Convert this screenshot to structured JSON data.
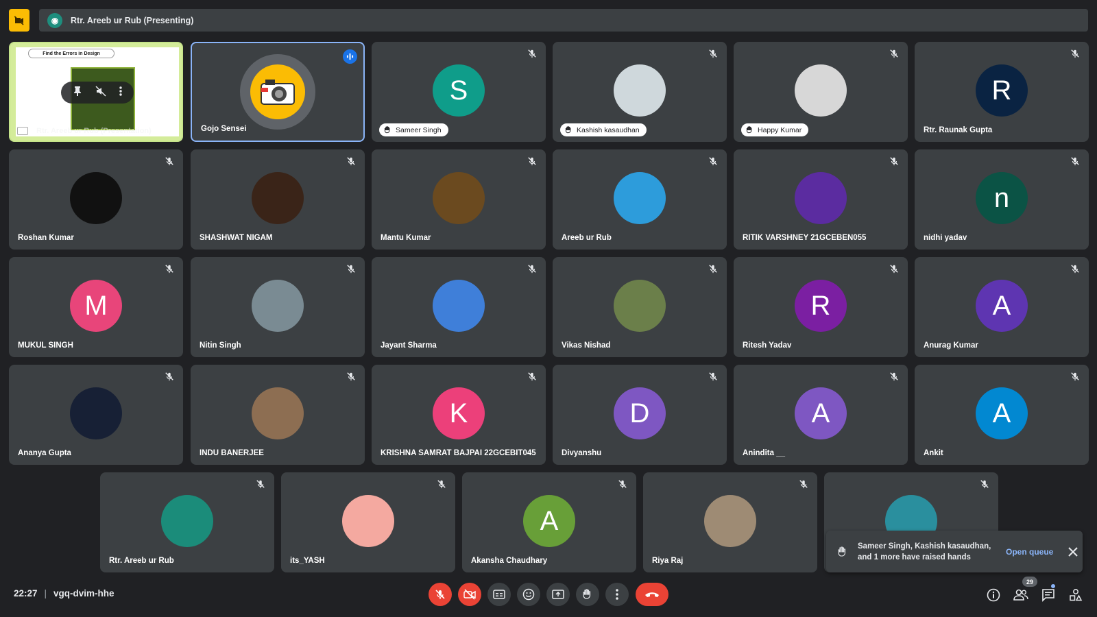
{
  "presenting_bar": {
    "text": "Rtr. Areeb ur Rub (Presenting)"
  },
  "presentation_tile": {
    "slide_title": "Find the Errors in Design",
    "label": "Rtr. Areeb ur Rub (Presentation)"
  },
  "gojo": {
    "name": "Gojo Sensei"
  },
  "tiles": [
    {
      "name": "Sameer Singh",
      "initial": "S",
      "color": "#0f9d8a",
      "hand": true
    },
    {
      "name": "Kashish kasaudhan",
      "initial": "",
      "color": "#cfd8dc",
      "hand": true
    },
    {
      "name": "Happy Kumar",
      "initial": "",
      "color": "#d7d7d7",
      "hand": true
    },
    {
      "name": "Rtr. Raunak Gupta",
      "initial": "R",
      "color": "#0a2342",
      "hand": false
    },
    {
      "name": "Roshan Kumar",
      "initial": "",
      "color": "#111111",
      "hand": false
    },
    {
      "name": "SHASHWAT NIGAM",
      "initial": "",
      "color": "#3a2418",
      "hand": false
    },
    {
      "name": "Mantu Kumar",
      "initial": "",
      "color": "#6b4a1f",
      "hand": false
    },
    {
      "name": "Areeb ur Rub",
      "initial": "",
      "color": "#2d9cdb",
      "hand": false
    },
    {
      "name": "RITIK VARSHNEY 21GCEBEN055",
      "initial": "",
      "color": "#5b2ca0",
      "hand": false
    },
    {
      "name": "nidhi yadav",
      "initial": "n",
      "color": "#0b5345",
      "hand": false
    },
    {
      "name": "MUKUL SINGH",
      "initial": "M",
      "color": "#e8457a",
      "hand": false
    },
    {
      "name": "Nitin Singh",
      "initial": "",
      "color": "#7a8b93",
      "hand": false
    },
    {
      "name": "Jayant Sharma",
      "initial": "",
      "color": "#3f7fd9",
      "hand": false
    },
    {
      "name": "Vikas Nishad",
      "initial": "",
      "color": "#6b7f4a",
      "hand": false
    },
    {
      "name": "Ritesh Yadav",
      "initial": "R",
      "color": "#7b1fa2",
      "hand": false
    },
    {
      "name": "Anurag Kumar",
      "initial": "A",
      "color": "#5e35b1",
      "hand": false
    },
    {
      "name": "Ananya Gupta",
      "initial": "",
      "color": "#172035",
      "hand": false
    },
    {
      "name": "INDU BANERJEE",
      "initial": "",
      "color": "#8d6e52",
      "hand": false
    },
    {
      "name": "KRISHNA SAMRAT BAJPAI 22GCEBIT045",
      "initial": "K",
      "color": "#ec407a",
      "hand": false
    },
    {
      "name": "Divyanshu",
      "initial": "D",
      "color": "#7e57c2",
      "hand": false
    },
    {
      "name": "Anindita __",
      "initial": "A",
      "color": "#7e57c2",
      "hand": false
    },
    {
      "name": "Ankit",
      "initial": "A",
      "color": "#0288d1",
      "hand": false
    },
    {
      "name": "Rtr. Areeb ur Rub",
      "initial": "",
      "color": "#1b8c7a",
      "hand": false
    },
    {
      "name": "its_YASH",
      "initial": "",
      "color": "#f4a9a0",
      "hand": false
    },
    {
      "name": "Akansha Chaudhary",
      "initial": "A",
      "color": "#689f38",
      "hand": false
    },
    {
      "name": "Riya Raj",
      "initial": "",
      "color": "#9e8b74",
      "hand": false
    },
    {
      "name": "",
      "initial": "",
      "color": "#2a8f9e",
      "hand": false
    }
  ],
  "toast": {
    "message": "Sameer Singh, Kashish kasaudhan, and 1 more have raised hands",
    "action": "Open queue"
  },
  "bottom": {
    "time": "22:27",
    "separator": "|",
    "meeting_code": "vgq-dvim-hhe",
    "people_count": "29"
  },
  "icons": {
    "mic_off": "mic-off-icon",
    "hand": "raised-hand-icon",
    "cam_off": "camera-off-icon"
  },
  "colors": {
    "accent": "#8ab4f8",
    "danger": "#ea4335",
    "tile": "#3c4043",
    "bg": "#202124"
  }
}
